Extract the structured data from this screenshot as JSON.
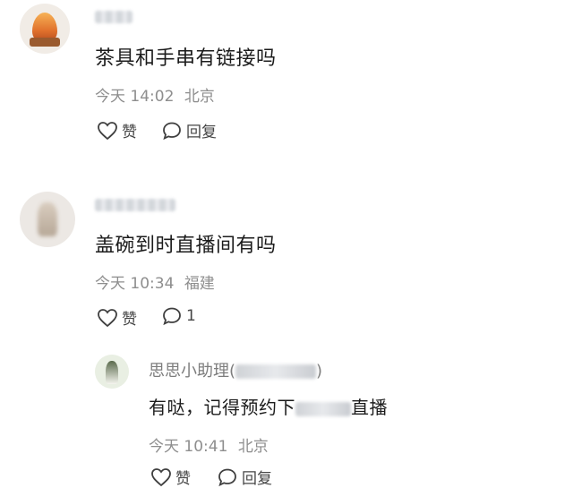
{
  "comments": [
    {
      "text": "茶具和手串有链接吗",
      "time": "今天 14:02",
      "location": "北京",
      "like_label": "赞",
      "reply_label": "回复"
    },
    {
      "text": "盖碗到时直播间有吗",
      "time": "今天 10:34",
      "location": "福建",
      "like_label": "赞",
      "reply_count": "1",
      "reply": {
        "author": "思思小助理(",
        "author_suffix": ")",
        "text_before": "有哒，记得预约下",
        "text_after": "直播",
        "time": "今天 10:41",
        "location": "北京",
        "like_label": "赞",
        "reply_label": "回复"
      }
    }
  ],
  "colors": {
    "text": "#1c1c1c",
    "meta": "#8e8e8e",
    "action": "#454545",
    "background": "#ffffff"
  }
}
